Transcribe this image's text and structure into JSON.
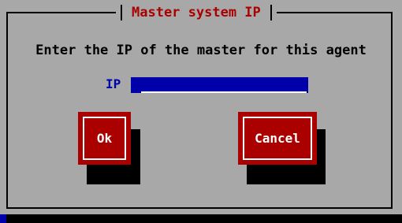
{
  "dialog": {
    "title": "Master system IP",
    "prompt": "Enter the IP of the master for this agent",
    "ip_label": "IP",
    "ip_value": ""
  },
  "buttons": {
    "ok_label": "Ok",
    "cancel_label": "Cancel"
  },
  "colors": {
    "screen_background": "#0000aa",
    "dialog_background": "#a8a8a8",
    "title_text": "#aa0000",
    "button_background": "#aa0000",
    "field_background": "#0000aa"
  }
}
